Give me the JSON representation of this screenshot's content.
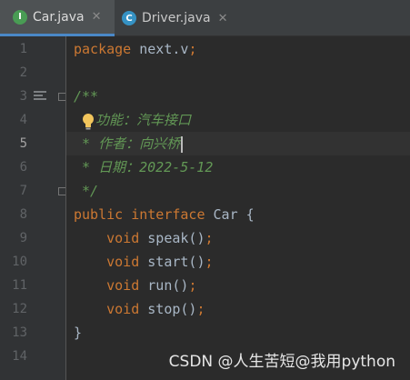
{
  "tabs": [
    {
      "label": "Car.java",
      "icon_letter": "I",
      "icon_color": "#499c54",
      "close": "✕",
      "active": true
    },
    {
      "label": "Driver.java",
      "icon_letter": "C",
      "icon_color": "#3592c4",
      "close": "✕",
      "active": false
    }
  ],
  "line_numbers": [
    "1",
    "2",
    "3",
    "4",
    "5",
    "6",
    "7",
    "8",
    "9",
    "10",
    "11",
    "12",
    "13",
    "14"
  ],
  "code": {
    "l1_kw": "package",
    "l1_rest": " next.v",
    "l1_semi": ";",
    "l3_cm": "/**",
    "l4_cm": "功能：汽车接口",
    "l5_star": " * ",
    "l5_cm": "作者：向兴桥",
    "l6_star": " * ",
    "l6_cm": "日期：2022-5-12",
    "l7_cm": " */",
    "l8_kw": "public interface",
    "l8_rest": " Car {",
    "methods": [
      {
        "kw": "void",
        "name": " speak()",
        "semi": ";"
      },
      {
        "kw": "void",
        "name": " start()",
        "semi": ";"
      },
      {
        "kw": "void",
        "name": " run()",
        "semi": ";"
      },
      {
        "kw": "void",
        "name": " stop()",
        "semi": ";"
      }
    ],
    "l13": "}"
  },
  "watermark": "CSDN @人生苦短@我用python",
  "colors": {
    "keyword": "#cc7832",
    "comment": "#629755",
    "text": "#a9b7c6",
    "background": "#2b2b2b"
  }
}
